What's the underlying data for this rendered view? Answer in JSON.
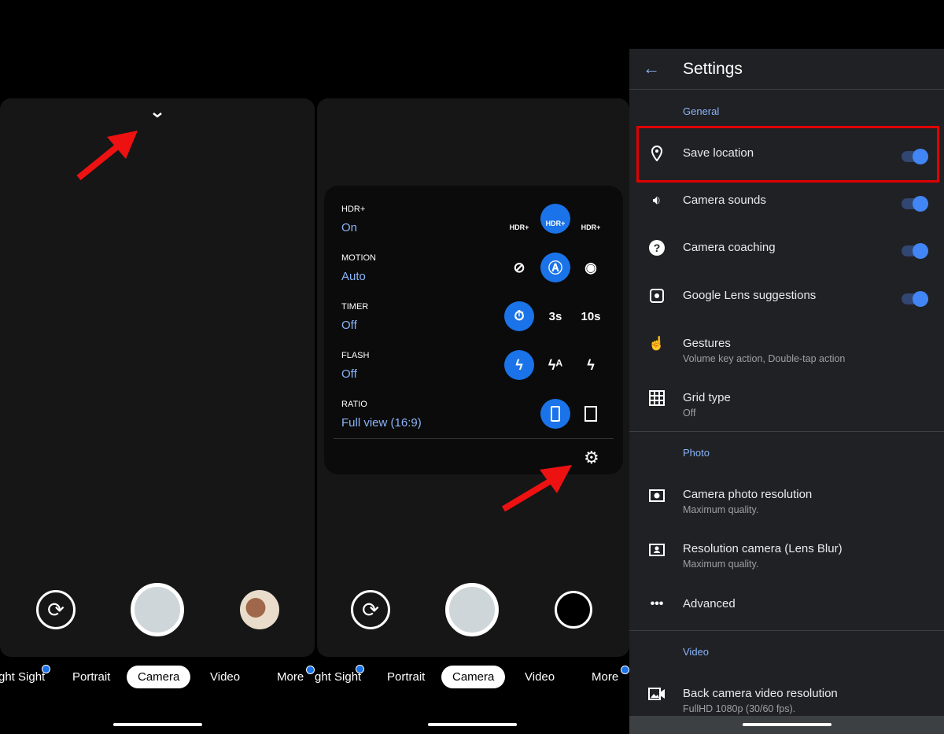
{
  "camera_modes": [
    "ght Sight",
    "Portrait",
    "Camera",
    "Video",
    "More"
  ],
  "quick_settings": [
    {
      "label": "HDR+",
      "value": "On",
      "options": [
        "hdr-off",
        "hdr-on",
        "hdr-enhanced"
      ],
      "option_text": [
        "HDR+",
        "HDR+",
        "HDR+"
      ],
      "selected": 1
    },
    {
      "label": "MOTION",
      "value": "Auto",
      "options": [
        "motion-off",
        "motion-auto",
        "motion-on"
      ],
      "selected": 1
    },
    {
      "label": "TIMER",
      "value": "Off",
      "options": [
        "timer-off",
        "timer-3s",
        "timer-10s"
      ],
      "option_text": [
        "",
        "3s",
        "10s"
      ],
      "selected": 0
    },
    {
      "label": "FLASH",
      "value": "Off",
      "options": [
        "flash-off",
        "flash-auto",
        "flash-on"
      ],
      "selected": 0
    },
    {
      "label": "RATIO",
      "value": "Full view (16:9)",
      "options": [
        "ratio-full",
        "ratio-square"
      ],
      "selected": 0
    }
  ],
  "settings": {
    "title": "Settings",
    "sections": {
      "general": "General",
      "photo": "Photo",
      "video": "Video"
    },
    "items": [
      {
        "title": "Save location",
        "icon": "location-pin-icon",
        "toggle": true
      },
      {
        "title": "Camera sounds",
        "icon": "speaker-icon",
        "toggle": true
      },
      {
        "title": "Camera coaching",
        "icon": "help-icon",
        "toggle": true
      },
      {
        "title": "Google Lens suggestions",
        "icon": "lens-icon",
        "toggle": true
      },
      {
        "title": "Gestures",
        "subtitle": "Volume key action, Double-tap action",
        "icon": "gesture-icon"
      },
      {
        "title": "Grid type",
        "subtitle": "Off",
        "icon": "grid-icon"
      },
      {
        "title": "Camera photo resolution",
        "subtitle": "Maximum quality.",
        "icon": "camera-icon"
      },
      {
        "title": "Resolution camera (Lens Blur)",
        "subtitle": "Maximum quality.",
        "icon": "portrait-camera-icon"
      },
      {
        "title": "Advanced",
        "icon": "more-icon"
      },
      {
        "title": "Back camera video resolution",
        "subtitle": "FullHD 1080p (30/60 fps).",
        "icon": "video-camera-icon"
      }
    ]
  },
  "colors": {
    "accent": "#1a73e8",
    "link": "#8ab4f8",
    "highlight": "#e00000",
    "settings_bg": "#202124"
  }
}
